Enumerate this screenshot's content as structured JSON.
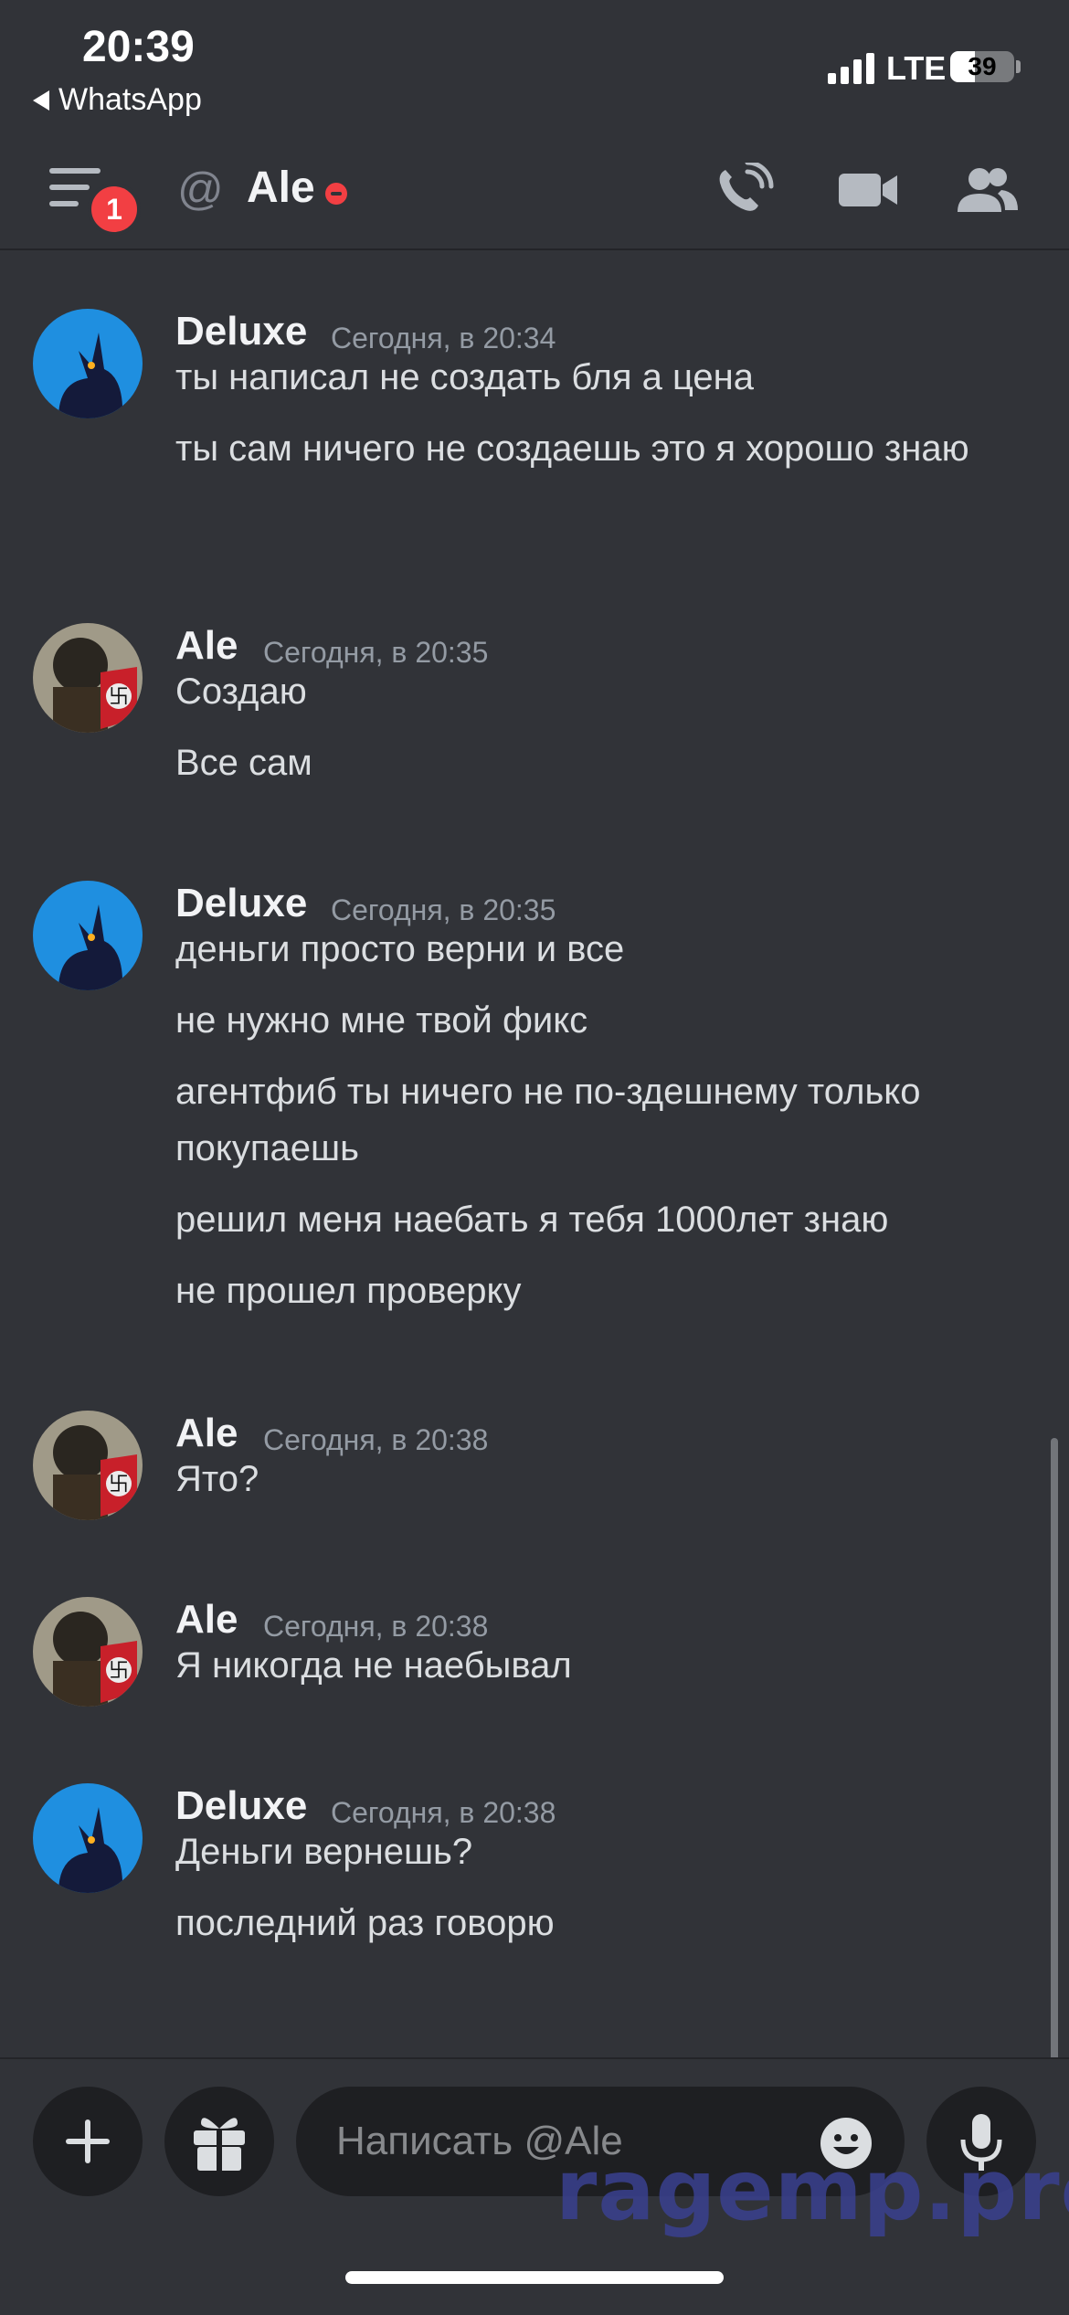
{
  "status_bar": {
    "time": "20:39",
    "back_app": "WhatsApp",
    "network": "LTE",
    "battery_level": "39",
    "battery_fraction": 0.39
  },
  "header": {
    "menu_badge": "1",
    "title": "Ale",
    "status": "dnd",
    "status_color": "#f23f43"
  },
  "messages": [
    {
      "author": "Deluxe",
      "time": "Сегодня, в 20:34",
      "avatar": "deluxe-avatar",
      "lines": [
        "ты написал не создать бля а цена",
        "ты сам ничего не создаешь это я хорошо знаю"
      ]
    },
    {
      "author": "Ale",
      "time": "Сегодня, в 20:35",
      "avatar": "ale-avatar",
      "lines": [
        "Создаю",
        "Все сам"
      ]
    },
    {
      "author": "Deluxe",
      "time": "Сегодня, в 20:35",
      "avatar": "deluxe-avatar",
      "lines": [
        "деньги просто верни и все",
        "не нужно мне твой фикс",
        "агентфиб ты ничего не по-здешнему только покупаешь",
        "решил меня наебать я тебя 1000лет знаю",
        "не прошел проверку"
      ]
    },
    {
      "author": "Ale",
      "time": "Сегодня, в 20:38",
      "avatar": "ale-avatar",
      "lines": [
        "Ято?"
      ]
    },
    {
      "author": "Ale",
      "time": "Сегодня, в 20:38",
      "avatar": "ale-avatar",
      "lines": [
        "Я никогда не наебывал"
      ]
    },
    {
      "author": "Deluxe",
      "time": "Сегодня, в 20:38",
      "avatar": "deluxe-avatar",
      "lines": [
        "Деньги вернешь?",
        "последний раз говорю"
      ]
    }
  ],
  "composer": {
    "placeholder": "Написать @Ale",
    "watermark": "ragemp.pro"
  },
  "colors": {
    "background": "#313338",
    "input_bg": "#1e1f22",
    "text": "#dbdee1",
    "muted": "#949ba4",
    "badge": "#f23f43"
  }
}
